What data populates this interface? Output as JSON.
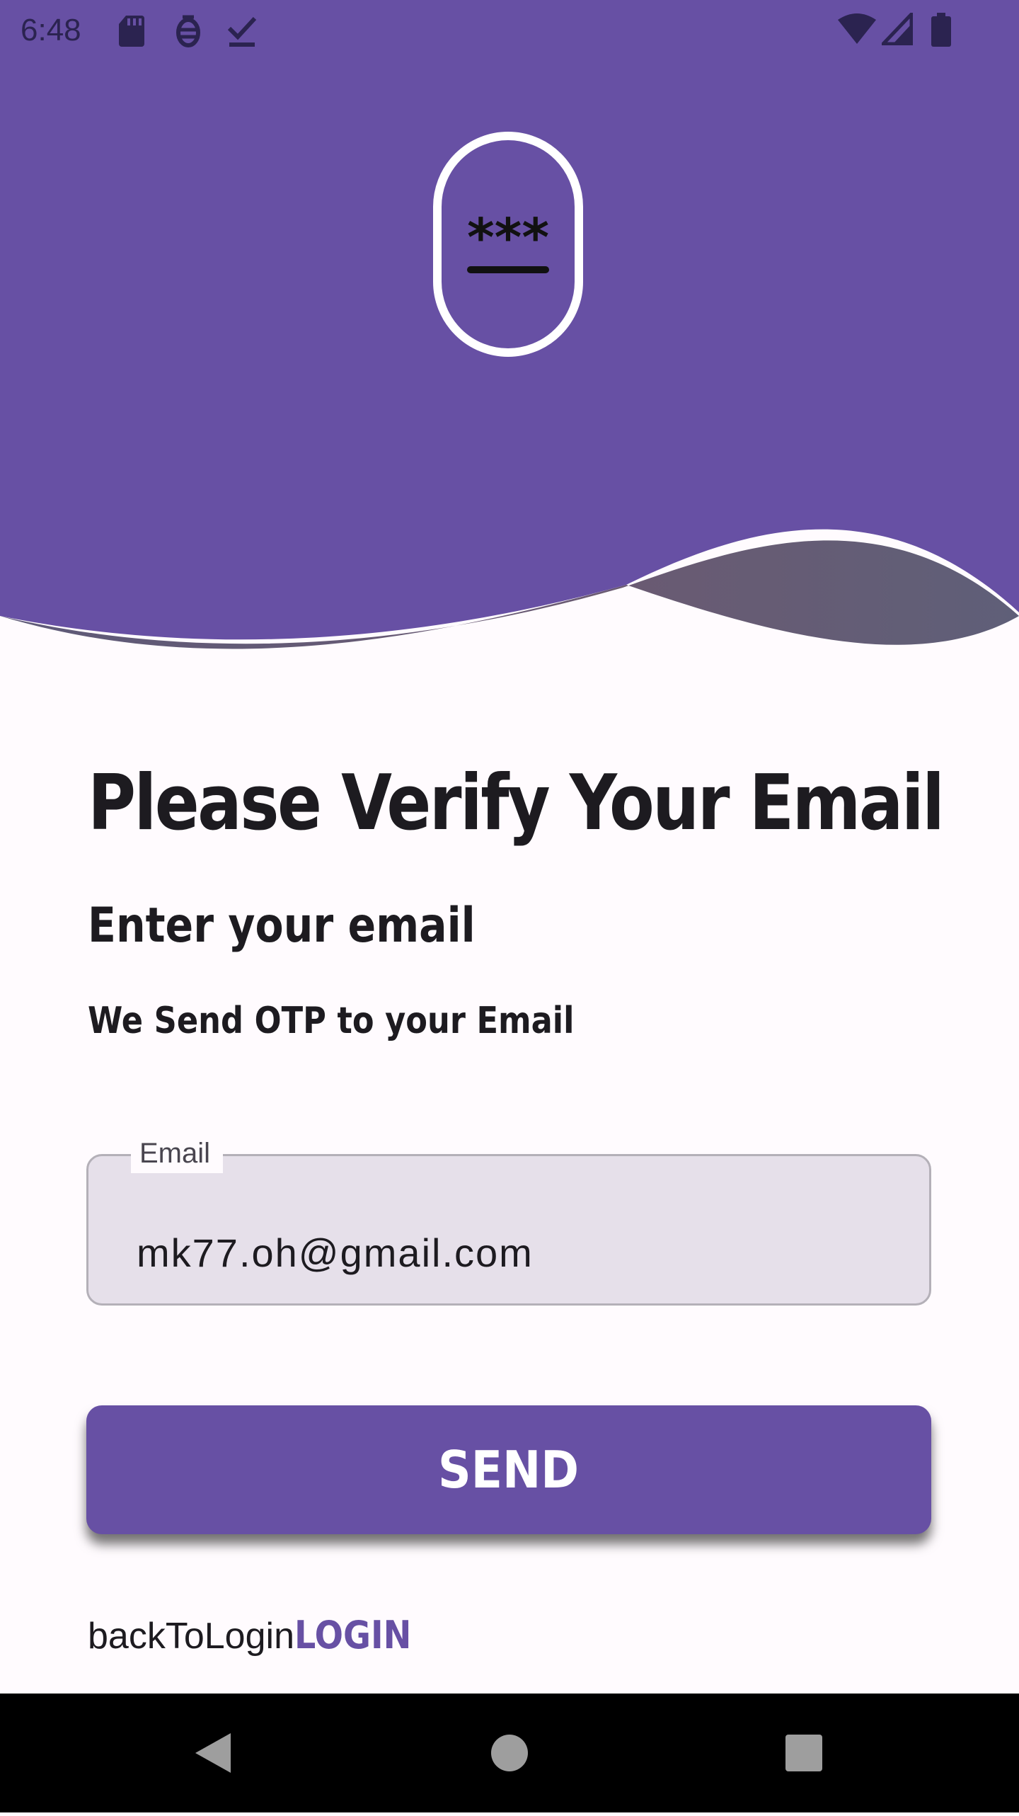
{
  "status_bar": {
    "time": "6:48",
    "left_icons": [
      "sd-card-icon",
      "debug-icon",
      "download-done-icon"
    ],
    "right_icons": [
      "wifi-icon",
      "cell-signal-icon",
      "battery-icon"
    ]
  },
  "header": {
    "background_color": "#6750a4",
    "logo_icon": "password-otp-icon",
    "logo_text": "***"
  },
  "title": "Please Verify Your Email",
  "subtitle": "Enter your email",
  "description": "We Send OTP to your Email",
  "email_field": {
    "label": "Email",
    "value": "mk77.oh@gmail.com"
  },
  "send_button": {
    "label": "SEND"
  },
  "back_to_login": {
    "text": "backToLogin",
    "link_label": "LOGIN"
  },
  "navigation_bar": {
    "buttons": [
      "back-icon",
      "home-icon",
      "recents-icon"
    ]
  },
  "colors": {
    "primary": "#6750a4",
    "surface": "#fffbfe",
    "field_fill": "#e6e0ea",
    "text": "#1d1b20"
  }
}
